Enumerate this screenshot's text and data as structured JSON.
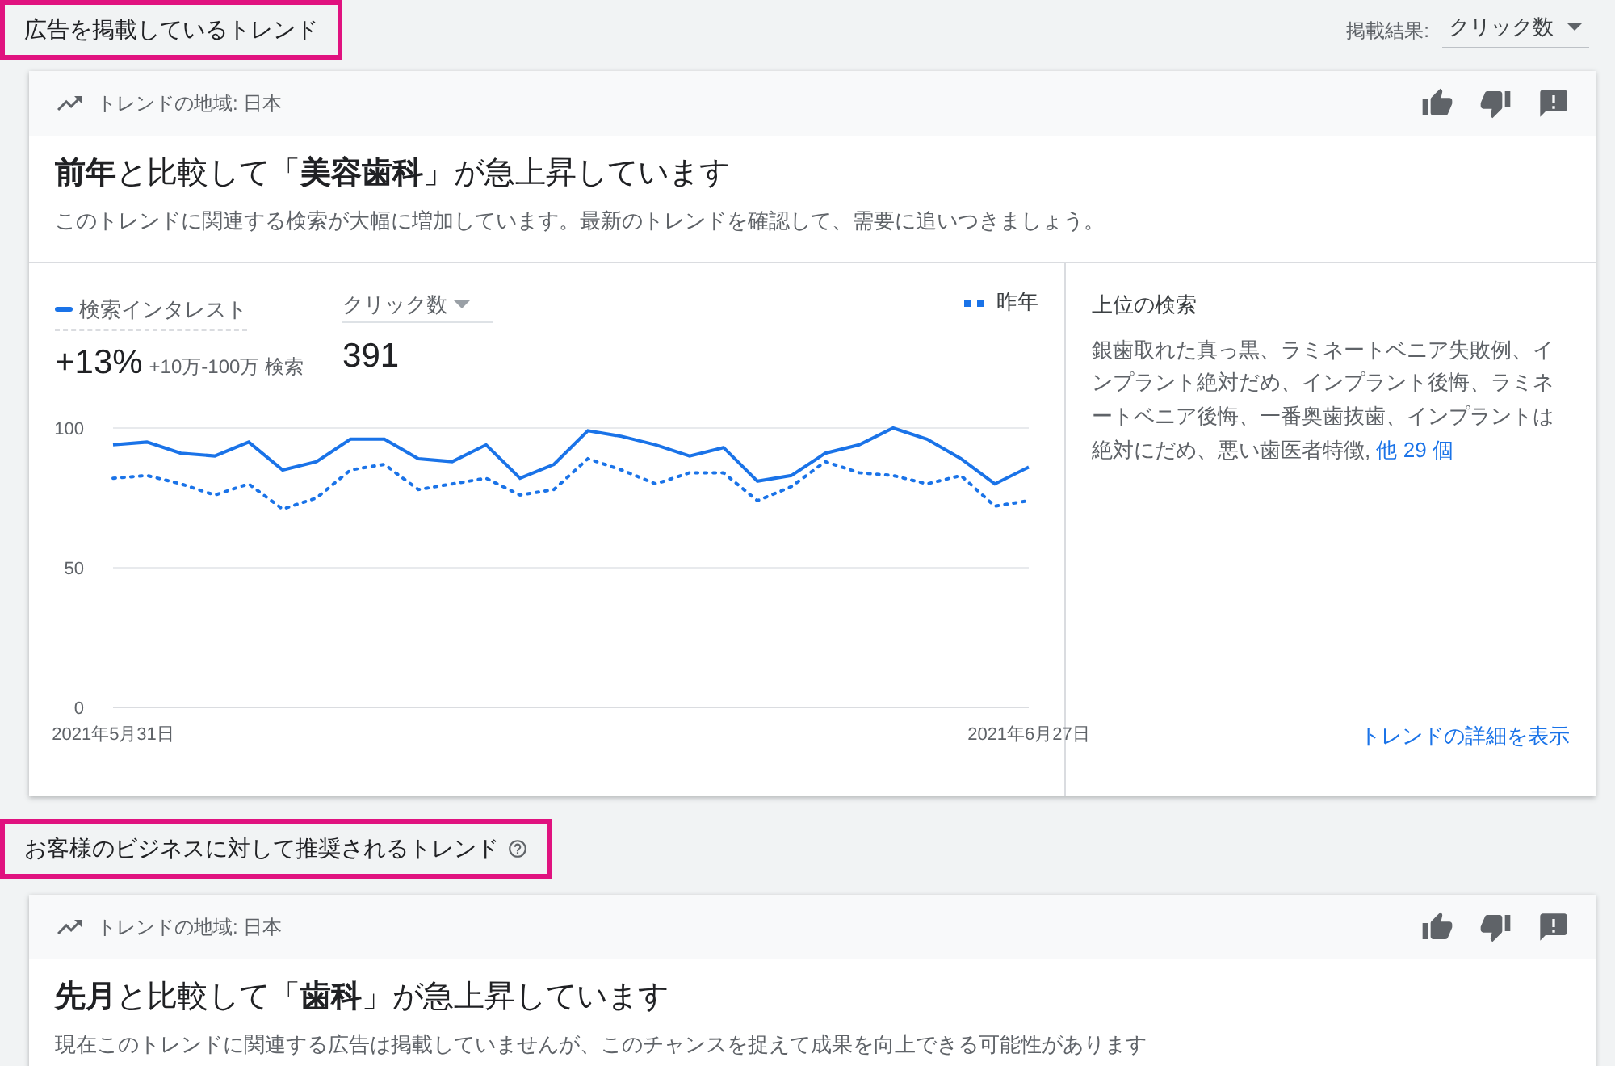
{
  "sections": [
    {
      "title": "広告を掲載しているトレンド",
      "has_help": false,
      "results_filter": {
        "label": "掲載結果:",
        "value": "クリック数"
      },
      "card": {
        "region": "トレンドの地域: 日本",
        "headline": "**前年**と比較して「**美容歯科**」が急上昇しています",
        "description": "このトレンドに関連する検索が大幅に増加しています。最新のトレンドを確認して、需要に追いつきましょう。",
        "metrics": [
          {
            "kind": "legend",
            "value": "+13%",
            "detail": "+10万-100万 検索"
          },
          {
            "kind": "dropdown",
            "label": "クリック数",
            "value": "391"
          }
        ],
        "chart_data": {
          "type": "line",
          "categories": [
            "2021年5月31日",
            null,
            null,
            null,
            null,
            null,
            null,
            null,
            null,
            null,
            null,
            null,
            null,
            null,
            null,
            null,
            null,
            null,
            null,
            null,
            null,
            null,
            null,
            null,
            null,
            null,
            null,
            "2021年6月27日"
          ],
          "yticks": [
            0,
            50,
            100
          ],
          "ylim": [
            0,
            100
          ],
          "series": [
            {
              "name": "検索インタレスト",
              "color": "#1a73e8",
              "line_style": "solid",
              "values": [
                94,
                95,
                91,
                90,
                95,
                85,
                88,
                96,
                96,
                89,
                88,
                94,
                82,
                87,
                99,
                97,
                94,
                90,
                93,
                81,
                83,
                91,
                94,
                100,
                96,
                89,
                80,
                86
              ]
            },
            {
              "name": "昨年",
              "color": "#1a73e8",
              "line_style": "dotted",
              "values": [
                82,
                83,
                80,
                76,
                80,
                71,
                75,
                85,
                87,
                78,
                80,
                82,
                76,
                78,
                89,
                85,
                80,
                84,
                84,
                74,
                79,
                88,
                84,
                83,
                80,
                83,
                72,
                74
              ]
            }
          ]
        },
        "top_searches": {
          "title": "上位の検索",
          "text": "銀歯取れた真っ黒、ラミネートベニア失敗例、インプラント絶対だめ、インプラント後悔、ラミネートベニア後悔、一番奥歯抜歯、インプラントは絶対にだめ、悪い歯医者特徴,",
          "more_link": "他 29 個",
          "details_link": "トレンドの詳細を表示"
        }
      }
    },
    {
      "title": "お客様のビジネスに対して推奨されるトレンド",
      "has_help": true,
      "card": {
        "region": "トレンドの地域: 日本",
        "headline": "**先月**と比較して「**歯科**」が急上昇しています",
        "description": "現在このトレンドに関連する広告は掲載していませんが、このチャンスを捉えて成果を向上できる可能性があります"
      }
    }
  ]
}
